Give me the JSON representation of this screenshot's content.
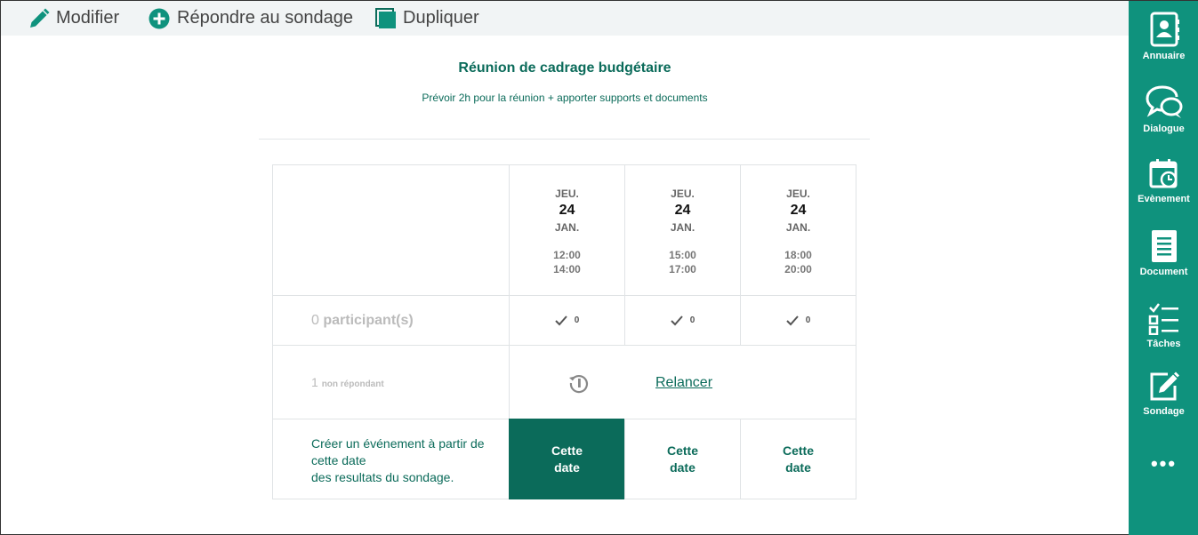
{
  "toolbar": {
    "modifier": "Modifier",
    "repondre": "Répondre au sondage",
    "dupliquer": "Dupliquer"
  },
  "poll": {
    "title": "Réunion de cadrage budgétaire",
    "subtitle": "Prévoir 2h pour la réunion + apporter supports et documents"
  },
  "dates": [
    {
      "day": "JEU.",
      "num": "24",
      "month": "JAN.",
      "start": "12:00",
      "end": "14:00",
      "votes": "0",
      "button": "Cette date"
    },
    {
      "day": "JEU.",
      "num": "24",
      "month": "JAN.",
      "start": "15:00",
      "end": "17:00",
      "votes": "0",
      "button": "Cette date"
    },
    {
      "day": "JEU.",
      "num": "24",
      "month": "JAN.",
      "start": "18:00",
      "end": "20:00",
      "votes": "0",
      "button": "Cette date"
    }
  ],
  "participants": {
    "count": "0",
    "label": "participant(s)"
  },
  "non_repondant": {
    "count": "1",
    "label": "non répondant"
  },
  "relancer": "Relancer",
  "create": {
    "line1": "Créer un événement à partir de cette date",
    "line2": "des resultats du sondage."
  },
  "sidebar": {
    "items": [
      {
        "label": "Annuaire",
        "icon": "address-book-icon"
      },
      {
        "label": "Dialogue",
        "icon": "chat-bubbles-icon"
      },
      {
        "label": "Evènement",
        "icon": "calendar-icon"
      },
      {
        "label": "Document",
        "icon": "document-icon"
      },
      {
        "label": "Tâches",
        "icon": "tasks-icon"
      },
      {
        "label": "Sondage",
        "icon": "poll-edit-icon"
      }
    ],
    "more": "•••"
  },
  "colors": {
    "brand": "#0b6b5a",
    "sidebar": "#0f927d",
    "toolbar": "#f1f4f5"
  }
}
